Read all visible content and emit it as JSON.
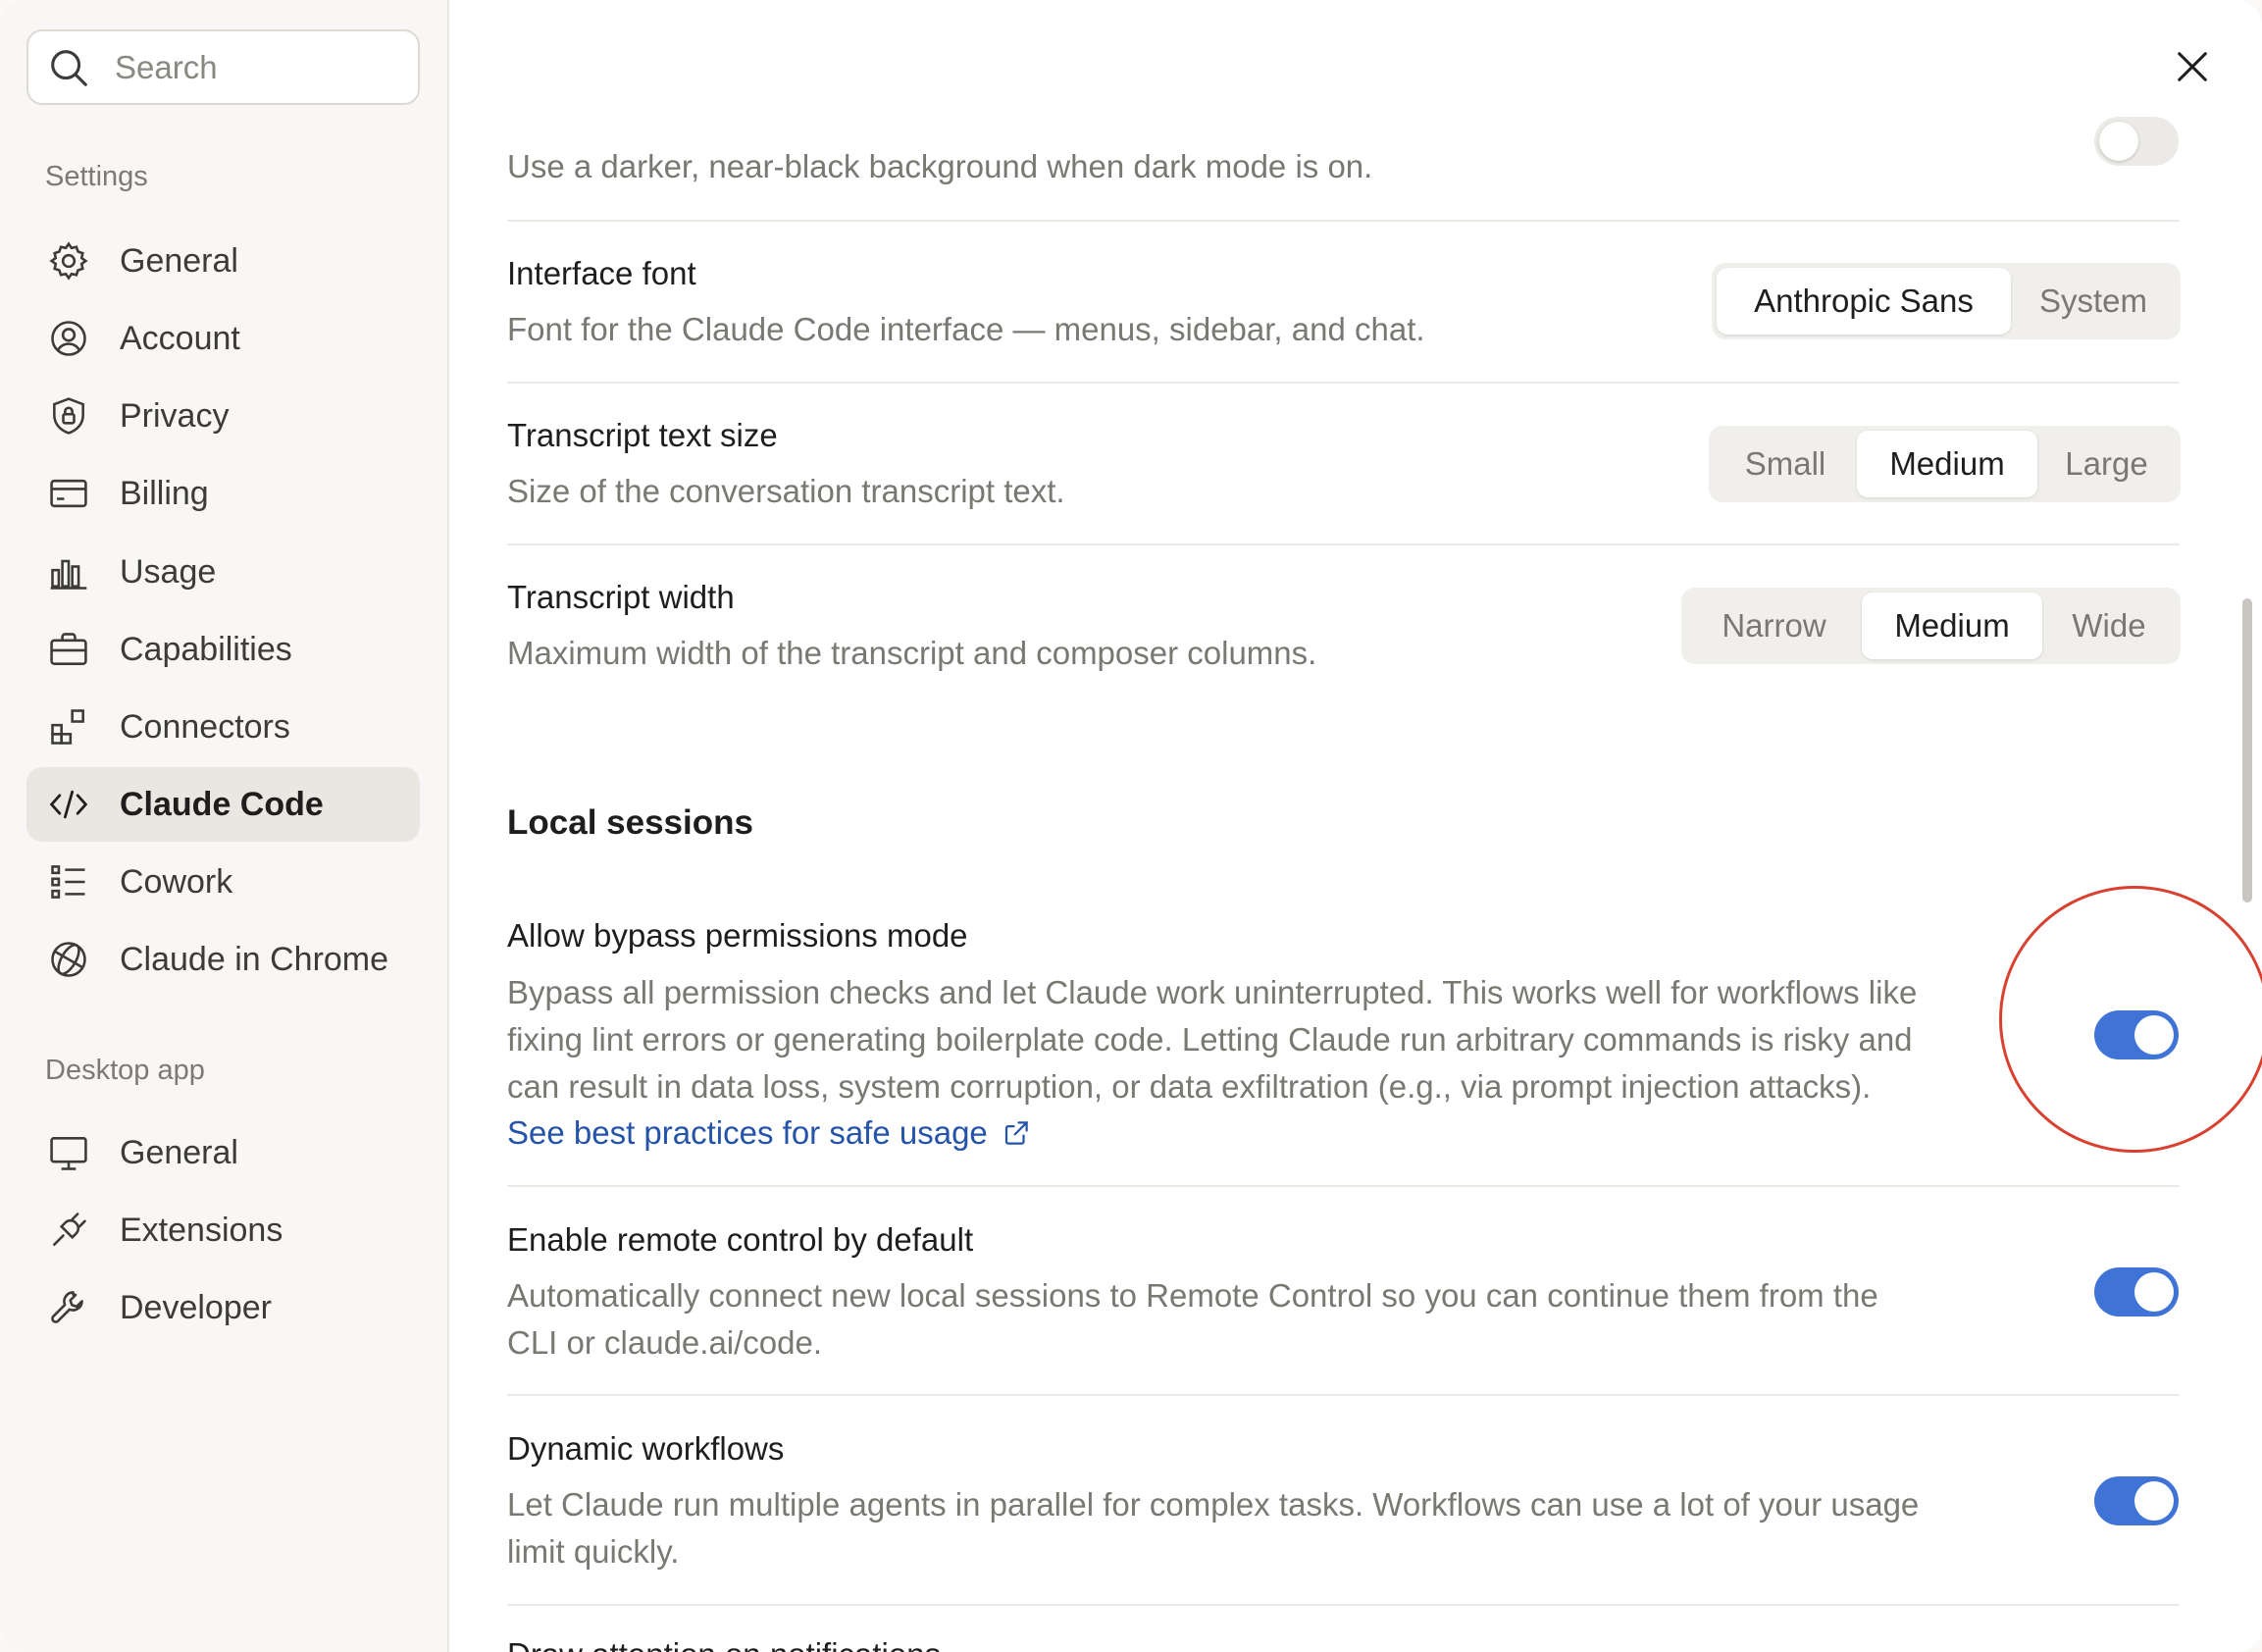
{
  "search": {
    "placeholder": "Search",
    "icon": "search-icon"
  },
  "sidebar": {
    "settings_label": "Settings",
    "settings_items": [
      {
        "label": "General",
        "icon": "gear-icon"
      },
      {
        "label": "Account",
        "icon": "user-circle-icon"
      },
      {
        "label": "Privacy",
        "icon": "shield-lock-icon"
      },
      {
        "label": "Billing",
        "icon": "credit-card-icon"
      },
      {
        "label": "Usage",
        "icon": "bar-chart-icon"
      },
      {
        "label": "Capabilities",
        "icon": "briefcase-icon"
      },
      {
        "label": "Connectors",
        "icon": "blocks-icon"
      },
      {
        "label": "Claude Code",
        "icon": "code-icon",
        "active": true
      },
      {
        "label": "Cowork",
        "icon": "checklist-icon"
      },
      {
        "label": "Claude in Chrome",
        "icon": "globe-icon"
      }
    ],
    "desktop_label": "Desktop app",
    "desktop_items": [
      {
        "label": "General",
        "icon": "monitor-icon"
      },
      {
        "label": "Extensions",
        "icon": "plug-icon"
      },
      {
        "label": "Developer",
        "icon": "wrench-icon"
      }
    ]
  },
  "main": {
    "dark_bg_desc": "Use a darker, near-black background when dark mode is on.",
    "interface_font": {
      "title": "Interface font",
      "desc": "Font for the Claude Code interface — menus, sidebar, and chat.",
      "options": [
        "Anthropic Sans",
        "System"
      ],
      "selected": "Anthropic Sans"
    },
    "text_size": {
      "title": "Transcript text size",
      "desc": "Size of the conversation transcript text.",
      "options": [
        "Small",
        "Medium",
        "Large"
      ],
      "selected": "Medium"
    },
    "width": {
      "title": "Transcript width",
      "desc": "Maximum width of the transcript and composer columns.",
      "options": [
        "Narrow",
        "Medium",
        "Wide"
      ],
      "selected": "Medium"
    },
    "local_sessions_heading": "Local sessions",
    "bypass": {
      "title": "Allow bypass permissions mode",
      "desc_line1": "Bypass all permission checks and let Claude work uninterrupted. This works well for workflows like",
      "desc_line2": "fixing lint errors or generating boilerplate code. Letting Claude run arbitrary commands is risky and",
      "desc_line3": "can result in data loss, system corruption, or data exfiltration (e.g., via prompt injection attacks).",
      "link": "See best practices for safe usage",
      "enabled": true
    },
    "remote": {
      "title": "Enable remote control by default",
      "desc_line1": "Automatically connect new local sessions to Remote Control so you can continue them from the",
      "desc_line2": "CLI or claude.ai/code.",
      "enabled": true
    },
    "dynamic": {
      "title": "Dynamic workflows",
      "desc_line1": "Let Claude run multiple agents in parallel for complex tasks. Workflows can use a lot of your usage",
      "desc_line2": "limit quickly.",
      "enabled": true
    },
    "next_title_partial": "Draw attention on notifications"
  },
  "colors": {
    "accent": "#3f74d6",
    "link": "#2453a8",
    "annotation": "#d8412f"
  }
}
